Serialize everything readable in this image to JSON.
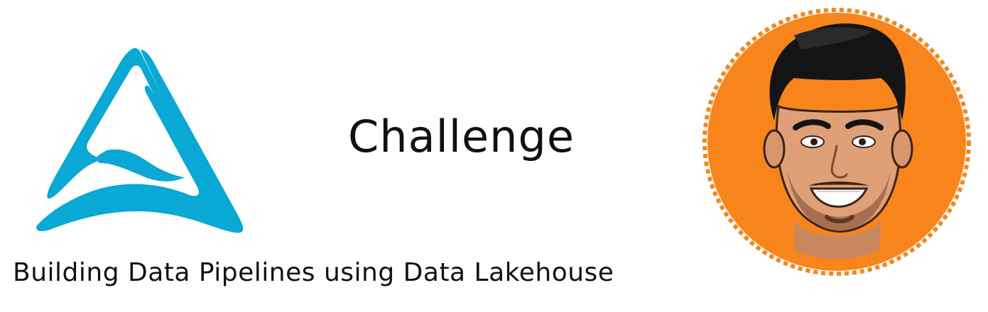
{
  "headline": "Challenge",
  "subtitle": "Building Data Pipelines using Data Lakehouse",
  "colors": {
    "logo": "#0aa8d4",
    "badge": "#f7851c",
    "hair": "#141414",
    "skin": "#e0a077",
    "text": "#111111"
  },
  "icons": {
    "logo": "triangle-wave-logo-icon",
    "avatar": "cartoon-avatar-icon"
  }
}
